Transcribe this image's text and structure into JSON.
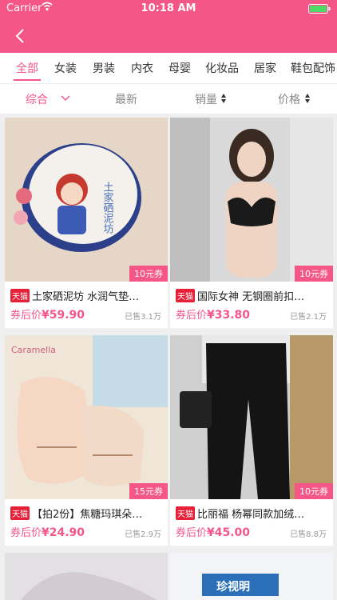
{
  "status": {
    "carrier": "Carrier",
    "time": "10:18 AM"
  },
  "categories": [
    "全部",
    "女装",
    "男装",
    "内衣",
    "母婴",
    "化妆品",
    "居家",
    "鞋包配饰"
  ],
  "sort": {
    "general": "综合",
    "newest": "最新",
    "sales": "销量",
    "price": "价格"
  },
  "tmall_label": "天猫",
  "price_prefix": "券后价",
  "products": [
    {
      "coupon": "10元券",
      "title": "土家硒泥坊 水润气垫…",
      "price": "¥59.90",
      "sold": "已售3.1万",
      "image_text": "土家硒泥坊"
    },
    {
      "coupon": "10元券",
      "title": "国际女神 无钢圈前扣…",
      "price": "¥33.80",
      "sold": "已售2.1万"
    },
    {
      "coupon": "15元券",
      "title": "【拍2份】焦糖玛琪朵…",
      "price": "¥24.90",
      "sold": "已售2.9万",
      "image_text": "Caramella"
    },
    {
      "coupon": "10元券",
      "title": "比丽福 杨幂同款加绒…",
      "price": "¥45.00",
      "sold": "已售8.8万"
    }
  ],
  "partial_image_text": "珍视明",
  "colors": {
    "accent": "#f55688",
    "tmall": "#e7203a"
  }
}
